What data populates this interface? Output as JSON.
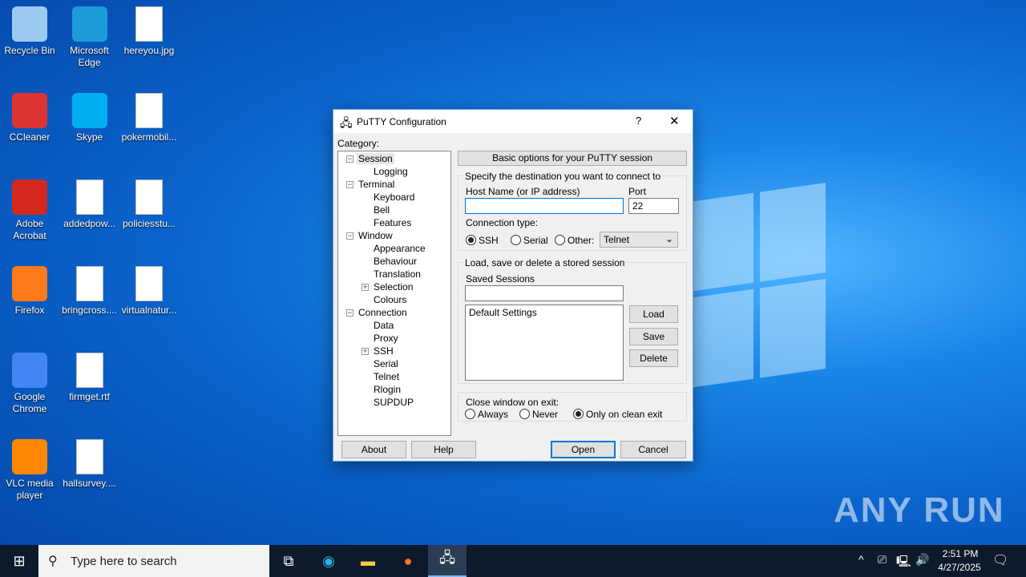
{
  "desktop": {
    "icons": [
      {
        "label": "Recycle Bin",
        "color": "#9cc9ef"
      },
      {
        "label": "Microsoft Edge",
        "color": "#1c9bd8"
      },
      {
        "label": "hereyou.jpg",
        "color": "#fff"
      },
      {
        "label": "CCleaner",
        "color": "#d33"
      },
      {
        "label": "Skype",
        "color": "#00aff0"
      },
      {
        "label": "pokermobil...",
        "color": "#fff"
      },
      {
        "label": "Adobe Acrobat",
        "color": "#d4281c"
      },
      {
        "label": "addedpow...",
        "color": "#fff"
      },
      {
        "label": "policiesstu...",
        "color": "#fff"
      },
      {
        "label": "Firefox",
        "color": "#ff7a1a"
      },
      {
        "label": "bringcross....",
        "color": "#fff"
      },
      {
        "label": "virtualnatur...",
        "color": "#fff"
      },
      {
        "label": "Google Chrome",
        "color": "#4285f4"
      },
      {
        "label": "firmget.rtf",
        "color": "#fff"
      },
      {
        "label": "VLC media player",
        "color": "#f80"
      },
      {
        "label": "hallsurvey....",
        "color": "#fff"
      }
    ],
    "watermark": "ANY RUN"
  },
  "dialog": {
    "title": "PuTTY Configuration",
    "help": "?",
    "close": "✕",
    "category_label": "Category:",
    "tree": [
      "Session",
      "Logging",
      "Terminal",
      "Keyboard",
      "Bell",
      "Features",
      "Window",
      "Appearance",
      "Behaviour",
      "Translation",
      "Selection",
      "Colours",
      "Connection",
      "Data",
      "Proxy",
      "SSH",
      "Serial",
      "Telnet",
      "Rlogin",
      "SUPDUP"
    ],
    "header": "Basic options for your PuTTY session",
    "dest_group": "Specify the destination you want to connect to",
    "host_label": "Host Name (or IP address)",
    "host_value": "",
    "port_label": "Port",
    "port_value": "22",
    "conn_type_label": "Connection type:",
    "conn_types": [
      "SSH",
      "Serial",
      "Other:"
    ],
    "selected_conn": "SSH",
    "other_select": "Telnet",
    "sessions_group": "Load, save or delete a stored session",
    "saved_sessions_label": "Saved Sessions",
    "saved_sessions_value": "",
    "sessions_list": [
      "Default Settings"
    ],
    "load": "Load",
    "save": "Save",
    "delete": "Delete",
    "close_exit_label": "Close window on exit:",
    "exit_options": [
      "Always",
      "Never",
      "Only on clean exit"
    ],
    "selected_exit": "Only on clean exit",
    "about": "About",
    "help_btn": "Help",
    "open": "Open",
    "cancel": "Cancel"
  },
  "taskbar": {
    "search_placeholder": "Type here to search",
    "time": "2:51 PM",
    "date": "4/27/2025"
  }
}
